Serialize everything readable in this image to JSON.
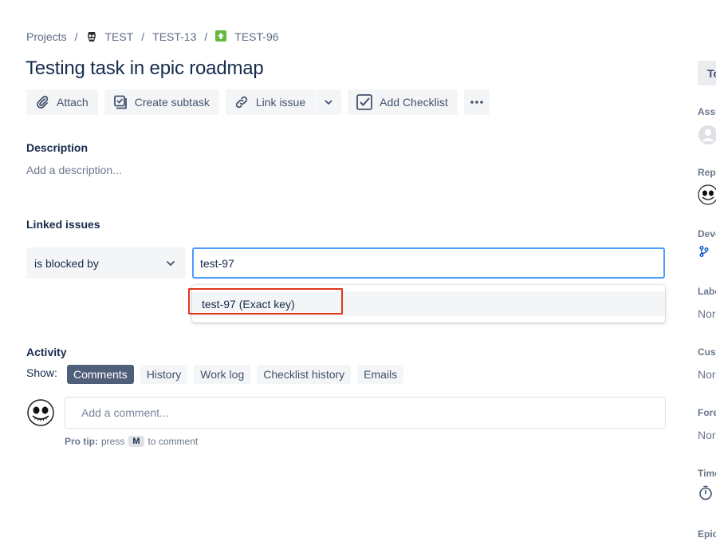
{
  "breadcrumb": {
    "items": [
      {
        "label": "Projects"
      },
      {
        "label": "TEST",
        "icon": "project-avatar-icon"
      },
      {
        "label": "TEST-13"
      },
      {
        "label": "TEST-96",
        "icon": "story-type-icon"
      }
    ],
    "separator": "/"
  },
  "issue": {
    "title": "Testing task in epic roadmap"
  },
  "toolbar": {
    "attach": "Attach",
    "create_subtask": "Create subtask",
    "link_issue": "Link issue",
    "add_checklist": "Add Checklist"
  },
  "description": {
    "label": "Description",
    "placeholder": "Add a description..."
  },
  "linked_issues": {
    "label": "Linked issues",
    "relation": "is blocked by",
    "search_value": "test-97",
    "suggestions": [
      {
        "label": "test-97 (Exact key)"
      }
    ]
  },
  "activity": {
    "label": "Activity",
    "show_label": "Show:",
    "filters": [
      {
        "label": "Comments",
        "active": true
      },
      {
        "label": "History",
        "active": false
      },
      {
        "label": "Work log",
        "active": false
      },
      {
        "label": "Checklist history",
        "active": false
      },
      {
        "label": "Emails",
        "active": false
      }
    ],
    "comment_placeholder": "Add a comment...",
    "protip": {
      "prefix": "Pro tip:",
      "press": "press",
      "key": "M",
      "suffix": "to comment"
    }
  },
  "sidebar": {
    "tab": "To",
    "fields": [
      {
        "label": "Assi"
      },
      {
        "label": "Repo"
      },
      {
        "label": "Deve"
      },
      {
        "label": "Labe",
        "value": "Nor"
      },
      {
        "label": "Cust",
        "value": "Nor"
      },
      {
        "label": "Fore",
        "value": "Nor"
      },
      {
        "label": "Time"
      },
      {
        "label": "Epic"
      }
    ]
  },
  "colors": {
    "focus_border": "#4c9aff",
    "highlight": "#e0371f",
    "active_filter": "#505f79",
    "story_icon": "#63ba3c"
  }
}
